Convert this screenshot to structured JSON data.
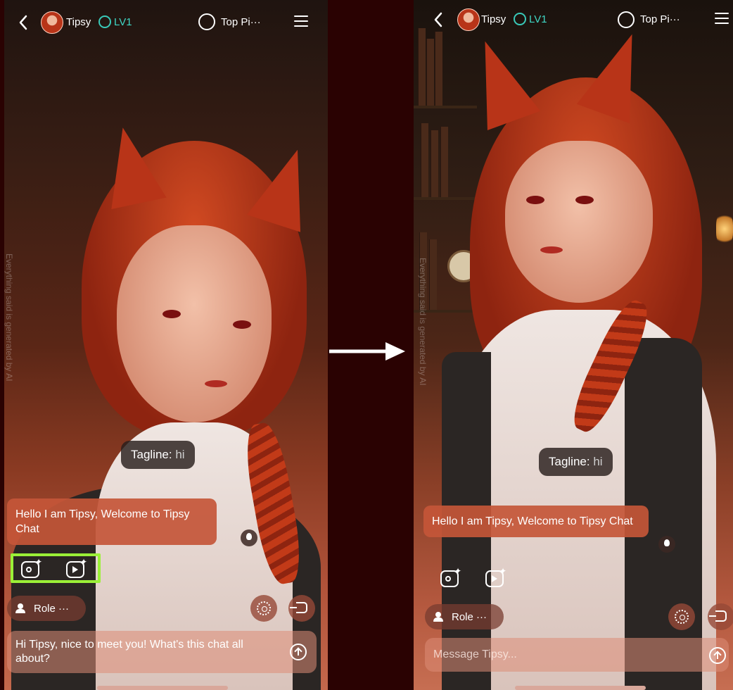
{
  "left": {
    "header": {
      "bot_name": "Tipsy",
      "level": "LV1",
      "topic": "Top Pi···"
    },
    "tagline": {
      "label": "Tagline:",
      "value": " hi"
    },
    "greeting": "Hello I am Tipsy, Welcome to Tipsy Chat",
    "role_label": "Role ···",
    "input_value": "Hi Tipsy, nice to meet you! What's this chat all about?",
    "watermark": "Everything said is generated by AI"
  },
  "right": {
    "header": {
      "bot_name": "Tipsy",
      "level": "LV1",
      "topic": "Top Pi···"
    },
    "tagline": {
      "label": "Tagline:",
      "value": " hi"
    },
    "greeting": "Hello I am Tipsy, Welcome to Tipsy Chat",
    "role_label": "Role ···",
    "input_placeholder": "Message Tipsy...",
    "watermark": "Everything said is generated by AI"
  },
  "colors": {
    "highlight": "#9bf037",
    "level_accent": "#3fd6c4",
    "bubble": "#c45638",
    "divider_bg": "#2a0202"
  },
  "icons": [
    "back-icon",
    "avatar",
    "level-icon",
    "swap-icon",
    "menu-icon",
    "hint-icon",
    "image-gen-icon",
    "video-gen-icon",
    "person-icon",
    "voice-icon",
    "exit-icon",
    "send-icon",
    "arrow-icon"
  ]
}
